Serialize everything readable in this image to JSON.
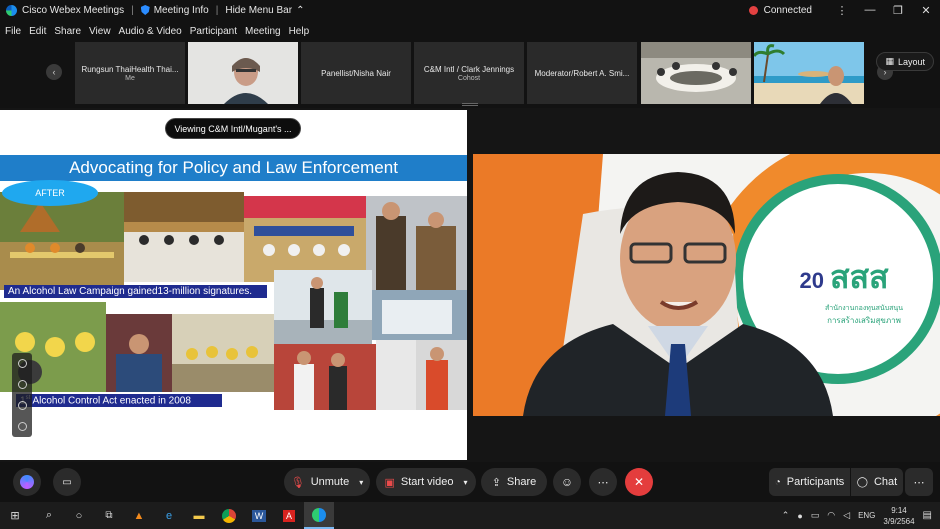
{
  "titlebar": {
    "app_name": "Cisco Webex Meetings",
    "meeting_info": "Meeting Info",
    "hide_menu": "Hide Menu Bar",
    "status": "Connected"
  },
  "menu": [
    "File",
    "Edit",
    "Share",
    "View",
    "Audio & Video",
    "Participant",
    "Meeting",
    "Help"
  ],
  "filmstrip": {
    "tiles": [
      {
        "name": "Rungsun ThaiHealth Thai...",
        "sub": "Me"
      },
      {
        "name": "",
        "sub": ""
      },
      {
        "name": "Panellist/Nisha Nair",
        "sub": ""
      },
      {
        "name": "C&M Intl / Clark Jennings",
        "sub": "Cohost"
      },
      {
        "name": "Moderator/Robert A. Smi...",
        "sub": ""
      },
      {
        "name": "",
        "sub": ""
      },
      {
        "name": "",
        "sub": ""
      }
    ],
    "layout_label": "Layout"
  },
  "share": {
    "viewing": "Viewing C&M Intl/Mugant's ...",
    "slide_title": "Advocating for Policy and Law Enforcement",
    "after_badge": "AFTER",
    "caption1": "An Alcohol Law Campaign gained13-million signatures.",
    "caption2_sup": "st",
    "caption2_num": "1",
    "caption2": " Alcohol Control Act enacted in 2008"
  },
  "speaker": {
    "logo_20": "20",
    "logo_text": "สสส",
    "logo_sub1": "สำนักงานกองทุนสนับสนุน",
    "logo_sub2": "การสร้างเสริมสุขภาพ"
  },
  "controls": {
    "unmute": "Unmute",
    "start_video": "Start video",
    "share": "Share",
    "participants": "Participants",
    "chat": "Chat"
  },
  "taskbar": {
    "lang": "ENG",
    "time": "9:14",
    "date": "3/9/2564"
  }
}
